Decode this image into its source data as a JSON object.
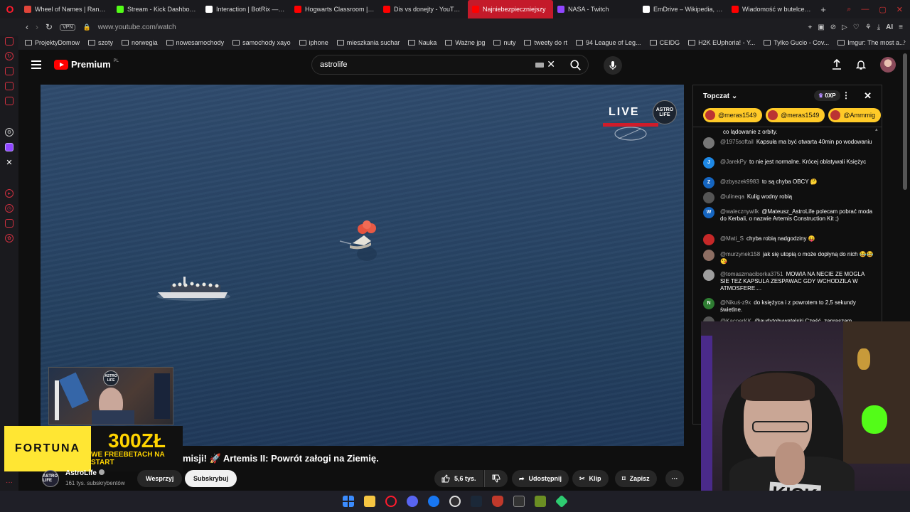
{
  "browser": {
    "tabs": [
      {
        "label": "Wheel of Names | Random",
        "color": "#e0453a"
      },
      {
        "label": "Stream - Kick Dashboard",
        "color": "#53fc18"
      },
      {
        "label": "Interaction | BotRix — Cl",
        "color": "#ffffff"
      },
      {
        "label": "Hogwarts Classroom | Ha",
        "color": "#ff0000"
      },
      {
        "label": "Dis vs donejty - YouTube",
        "color": "#ff0000"
      },
      {
        "label": "Najniebezpieczniejszy",
        "color": "#ff0000",
        "active": true
      },
      {
        "label": "NASA - Twitch",
        "color": "#9146ff"
      },
      {
        "label": "EmDrive – Wikipedia, woln",
        "color": "#ffffff"
      },
      {
        "label": "Wiadomość w butelce - Y",
        "color": "#ff0000"
      }
    ],
    "url": "www.youtube.com/watch",
    "vpn_label": "VPN",
    "ai_label": "AI",
    "bookmarks": [
      "ProjektyDomow",
      "szoty",
      "norwegia",
      "nowesamochody",
      "samochody xayo",
      "iphone",
      "mieszkania suchar",
      "Nauka",
      "Ważne jpg",
      "nuty",
      "tweety do rt",
      "94 League of Leg...",
      "CEIDG",
      "H2K EUphoria! - Y...",
      "Tylko Gucio - Cov...",
      "Imgur: The most a..."
    ]
  },
  "youtube": {
    "logo_text": "Premium",
    "logo_sup": "PL",
    "search_value": "astrolife"
  },
  "player": {
    "live_label": "LIVE",
    "astro_logo": "ASTRO LIFE"
  },
  "pip": {
    "label": "ASTRO LIFE"
  },
  "ad": {
    "brand": "FORTUNA",
    "amount": "300ZŁ",
    "tagline": "WE FREEBETACH NA START"
  },
  "video": {
    "title": "misji! 🚀 Artemis II: Powrót załogi na Ziemię.",
    "channel_name": "AstroLife",
    "channel_avatar": "ASTRO LIFE",
    "subscribers": "161 tys. subskrybentów",
    "support_label": "Wesprzyj",
    "subscribe_label": "Subskrybuj",
    "likes": "5,6 tys.",
    "share_label": "Udostępnij",
    "clip_label": "Klip",
    "save_label": "Zapisz"
  },
  "chat": {
    "mode_label": "Topczat",
    "xp_label": "0XP",
    "tickers": [
      "@meras1549",
      "@meras1549",
      "@Ammmig"
    ],
    "messages": [
      {
        "author": "",
        "text": "co lądowanie z orbity.",
        "avatar": "",
        "avatar_color": "#0f0f0f"
      },
      {
        "author": "@1975softail",
        "text": "Kapsuła ma być otwarta 40min po wodowaniu",
        "avatar": "",
        "avatar_color": "#777777"
      },
      {
        "author": "@JarekPy",
        "text": "to nie jest normalne. Krócej oblatywali Księżyc",
        "avatar": "J",
        "avatar_color": "#1e88e5"
      },
      {
        "author": "@zbyszek9983",
        "text": "to są chyba OBCY 🤔",
        "avatar": "Z",
        "avatar_color": "#1565c0"
      },
      {
        "author": "@ulineqa",
        "text": "Kulig wodny robią",
        "avatar": "",
        "avatar_color": "#555555"
      },
      {
        "author": "@walecznywilk",
        "text": "@Mateusz_AstroLife polecam pobrać moda do Kerbali, o nazwie Artemis Construction Kit ;)",
        "avatar": "W",
        "avatar_color": "#1565c0"
      },
      {
        "author": "@Mati_S",
        "text": "chyba robią nadgodziny 😝",
        "avatar": "",
        "avatar_color": "#c62828"
      },
      {
        "author": "@murzynek158",
        "text": "jak się utopią o może dopłyną do nich 😂😂😘",
        "avatar": "",
        "avatar_color": "#8d6e63"
      },
      {
        "author": "@tomaszmaciborka3751",
        "text": "MOWIA NA NECIE ZE MOGLA SIE TEZ KAPSULA ZESPAWAC GDY WCHODZILA W ATMOSFERE....",
        "avatar": "",
        "avatar_color": "#9e9e9e"
      },
      {
        "author": "@Nikuś-z9x",
        "text": "do księżyca i z powrotem to 2,5 sekundy świetlne.",
        "avatar": "N",
        "avatar_color": "#2e7d32"
      },
      {
        "author": "@KacperKK",
        "text": "@audytobywatelski Cześć, zapraszam",
        "avatar": "",
        "avatar_color": "#555555"
      }
    ]
  },
  "webcam": {
    "shirt_text": "KICK"
  },
  "colors": {
    "accent": "#ff0000",
    "opera": "#ff1b2d",
    "super_chat": "#ffca28",
    "kick": "#53fc18"
  }
}
